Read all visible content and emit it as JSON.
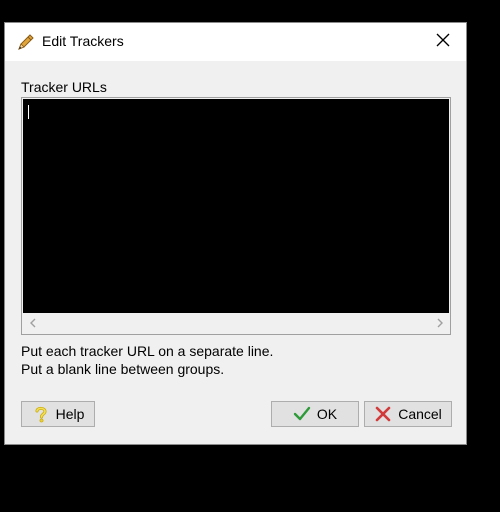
{
  "window": {
    "title": "Edit Trackers"
  },
  "editor": {
    "label": "Tracker URLs",
    "value": ""
  },
  "hints": {
    "line1": "Put each tracker URL on a separate line.",
    "line2": "Put a blank line between groups."
  },
  "buttons": {
    "help": "Help",
    "ok": "OK",
    "cancel": "Cancel"
  },
  "icons": {
    "title": "pencil-icon",
    "close": "close-icon",
    "help": "question-mark-icon",
    "ok": "checkmark-icon",
    "cancel": "x-icon"
  },
  "colors": {
    "ok_check": "#2e9b3a",
    "cancel_x": "#d23a3a",
    "help_qmark": "#e9cf3b"
  }
}
